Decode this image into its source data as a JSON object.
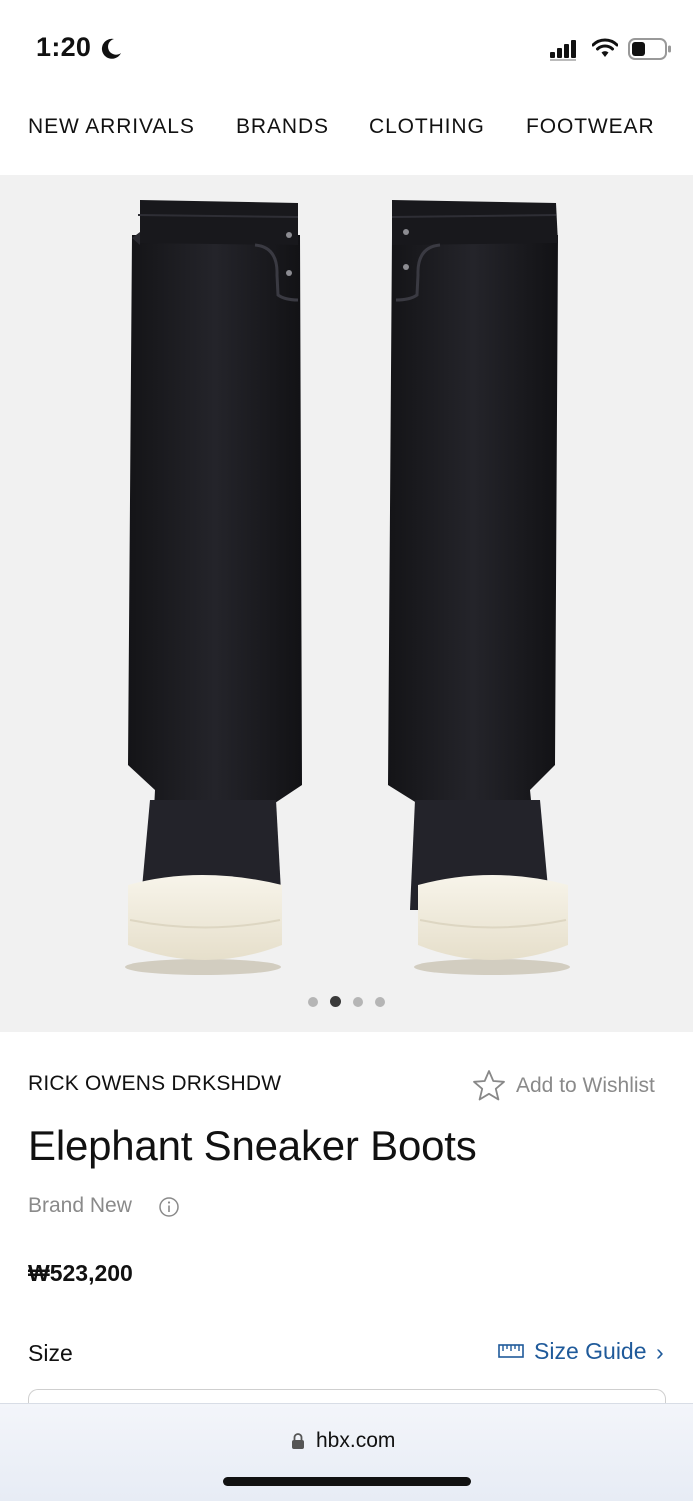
{
  "status_bar": {
    "time": "1:20",
    "icons": [
      "moon-icon",
      "signal-icon",
      "wifi-icon",
      "battery-icon"
    ]
  },
  "nav": {
    "items": [
      "NEW ARRIVALS",
      "BRANDS",
      "CLOTHING",
      "FOOTWEAR"
    ]
  },
  "gallery": {
    "image_count": 4,
    "active_index": 1,
    "background": "#f1f1f1"
  },
  "product": {
    "brand": "RICK OWENS DRKSHDW",
    "wishlist_label": "Add to Wishlist",
    "title": "Elephant Sneaker Boots",
    "condition": "Brand New",
    "price": "₩523,200",
    "size_label": "Size",
    "size_guide_label": "Size Guide",
    "size_guide_chevron": "›"
  },
  "browser": {
    "url": "hbx.com"
  },
  "colors": {
    "link": "#1f5a9a",
    "muted": "#8a8a8a",
    "boot": "#1c1c20",
    "sole": "#f3efe2"
  }
}
